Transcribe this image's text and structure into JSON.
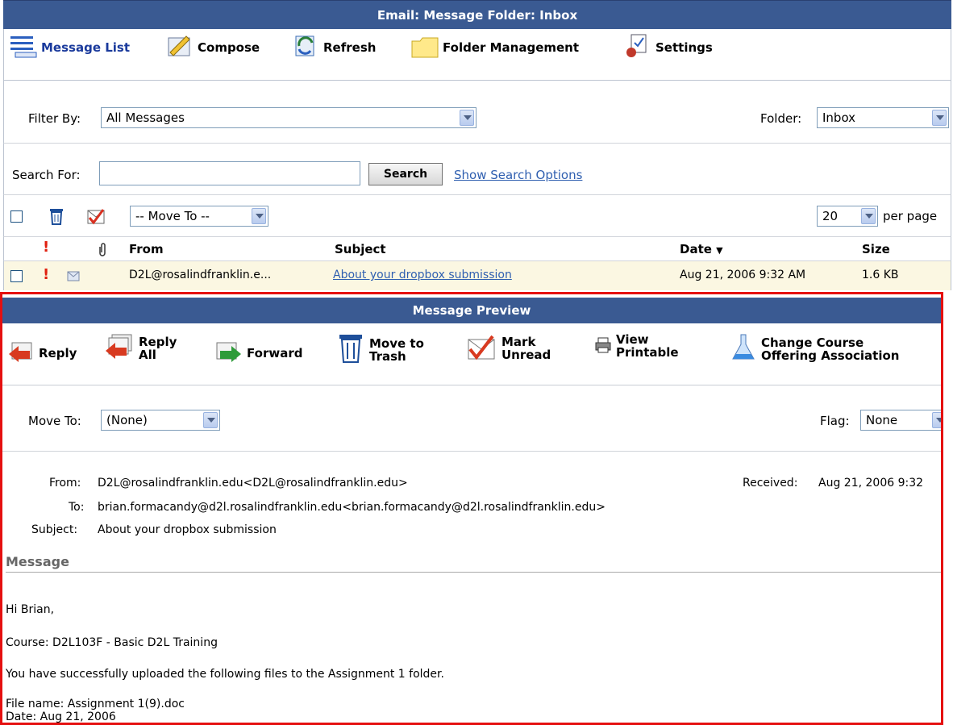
{
  "window_title": "Email: Message Folder: Inbox",
  "toolbar": {
    "message_list": "Message List",
    "compose": "Compose",
    "refresh": "Refresh",
    "folder_management": "Folder Management",
    "settings": "Settings"
  },
  "filter": {
    "label": "Filter By:",
    "value": "All Messages",
    "folder_label": "Folder:",
    "folder_value": "Inbox"
  },
  "search": {
    "label": "Search For:",
    "value": "",
    "button": "Search",
    "options_link": "Show Search Options"
  },
  "actions": {
    "move_to": "-- Move To --",
    "per_page_value": "20",
    "per_page_label": "per page"
  },
  "columns": {
    "from": "From",
    "subject": "Subject",
    "date": "Date",
    "date_sort": "▼",
    "size": "Size"
  },
  "messages": [
    {
      "from": "D2L@rosalindfranklin.e...",
      "subject": "About your dropbox submission",
      "date": "Aug 21, 2006 9:32 AM",
      "size": "1.6 KB"
    }
  ],
  "preview": {
    "title": "Message Preview",
    "buttons": {
      "reply": "Reply",
      "reply_all": "Reply\nAll",
      "forward": "Forward",
      "move_to_trash": "Move to\nTrash",
      "mark_unread": "Mark\nUnread",
      "view_printable": "View\nPrintable",
      "change_course": "Change Course\nOffering Association"
    },
    "move_to_label": "Move To:",
    "move_to_value": "(None)",
    "flag_label": "Flag:",
    "flag_value": "None",
    "from_label": "From:",
    "from_value": "D2L@rosalindfranklin.edu<D2L@rosalindfranklin.edu>",
    "received_label": "Received:",
    "received_value": "Aug 21, 2006 9:32",
    "to_label": "To:",
    "to_value": "brian.formacandy@d2l.rosalindfranklin.edu<brian.formacandy@d2l.rosalindfranklin.edu>",
    "subject_label": "Subject:",
    "subject_value": "About your dropbox submission",
    "message_heading": "Message",
    "body": [
      "Hi Brian,",
      "Course: D2L103F - Basic D2L Training",
      "You have successfully uploaded the following files to the Assignment 1 folder.",
      "File name: Assignment 1(9).doc",
      "Date: Aug 21, 2006"
    ]
  },
  "colors": {
    "header_bg": "#3a5a92",
    "highlight_border": "#e51010",
    "row_highlight": "#fbf7e2",
    "link": "#2f5fb0"
  }
}
